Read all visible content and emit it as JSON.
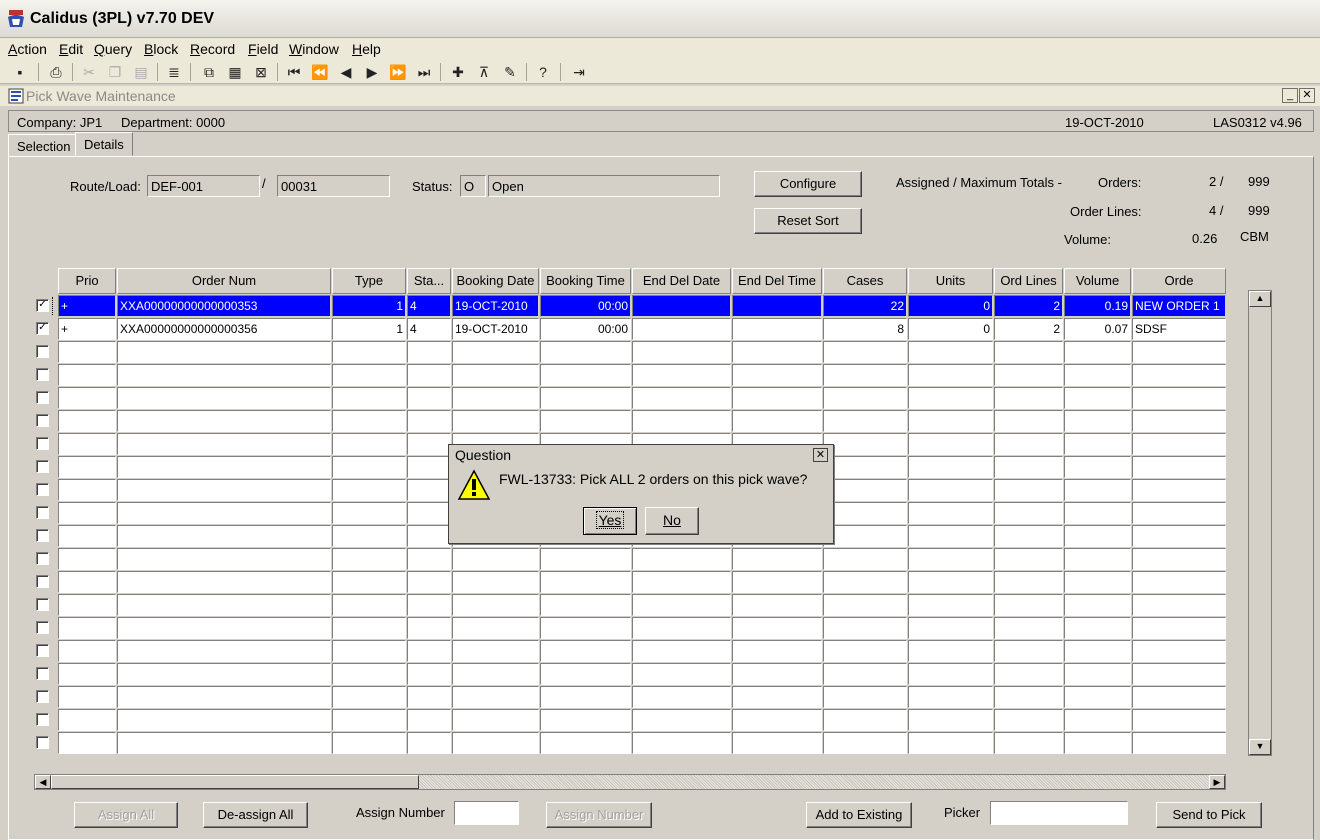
{
  "app": {
    "title": "Calidus (3PL) v7.70 DEV"
  },
  "menu": [
    "Action",
    "Edit",
    "Query",
    "Block",
    "Record",
    "Field",
    "Window",
    "Help"
  ],
  "window": {
    "title": "Pick Wave Maintenance",
    "min": "_",
    "close": "✕"
  },
  "company_bar": {
    "company": "Company:  JP1",
    "department": "Department:  0000",
    "date": "19-OCT-2010",
    "version": "LAS0312  v4.96"
  },
  "tabs": [
    "Selection",
    "Details"
  ],
  "form": {
    "route_label": "Route/Load:",
    "route": "DEF-001",
    "slash": "/",
    "load": "00031",
    "status_label": "Status:",
    "status_code": "O",
    "status_text": "Open",
    "configure": "Configure",
    "reset_sort": "Reset Sort",
    "totals_label": "Assigned / Maximum Totals -",
    "orders_label": "Orders:",
    "orders_assigned": "2 /",
    "orders_max": "999",
    "lines_label": "Order Lines:",
    "lines_assigned": "4 /",
    "lines_max": "999",
    "volume_label": "Volume:",
    "volume": "0.26",
    "volume_unit": "CBM"
  },
  "grid": {
    "headers": [
      "Prio",
      "Order Num",
      "Type",
      "Sta...",
      "Booking Date",
      "Booking Time",
      "End Del Date",
      "End Del Time",
      "Cases",
      "Units",
      "Ord Lines",
      "Volume",
      "Orde"
    ],
    "rows": [
      {
        "checked": true,
        "prio": "+",
        "order": "XXA00000000000000353",
        "type": "1",
        "status": "4",
        "bdate": "19-OCT-2010",
        "btime": "00:00",
        "edate": "",
        "etime": "",
        "cases": "22",
        "units": "0",
        "lines": "2",
        "volume": "0.19",
        "desc": "NEW ORDER 1"
      },
      {
        "checked": true,
        "prio": "+",
        "order": "XXA00000000000000356",
        "type": "1",
        "status": "4",
        "bdate": "19-OCT-2010",
        "btime": "00:00",
        "edate": "",
        "etime": "",
        "cases": "8",
        "units": "0",
        "lines": "2",
        "volume": "0.07",
        "desc": "SDSF"
      }
    ]
  },
  "bottom": {
    "assign_all": "Assign All",
    "deassign_all": "De-assign All",
    "assign_number_label": "Assign Number",
    "assign_number_btn": "Assign Number",
    "add_existing": "Add to Existing",
    "picker_label": "Picker",
    "send_to_pick": "Send to Pick"
  },
  "dialog": {
    "title": "Question",
    "message": "FWL-13733:  Pick ALL 2 orders on this pick wave?",
    "yes": "Yes",
    "no": "No"
  }
}
